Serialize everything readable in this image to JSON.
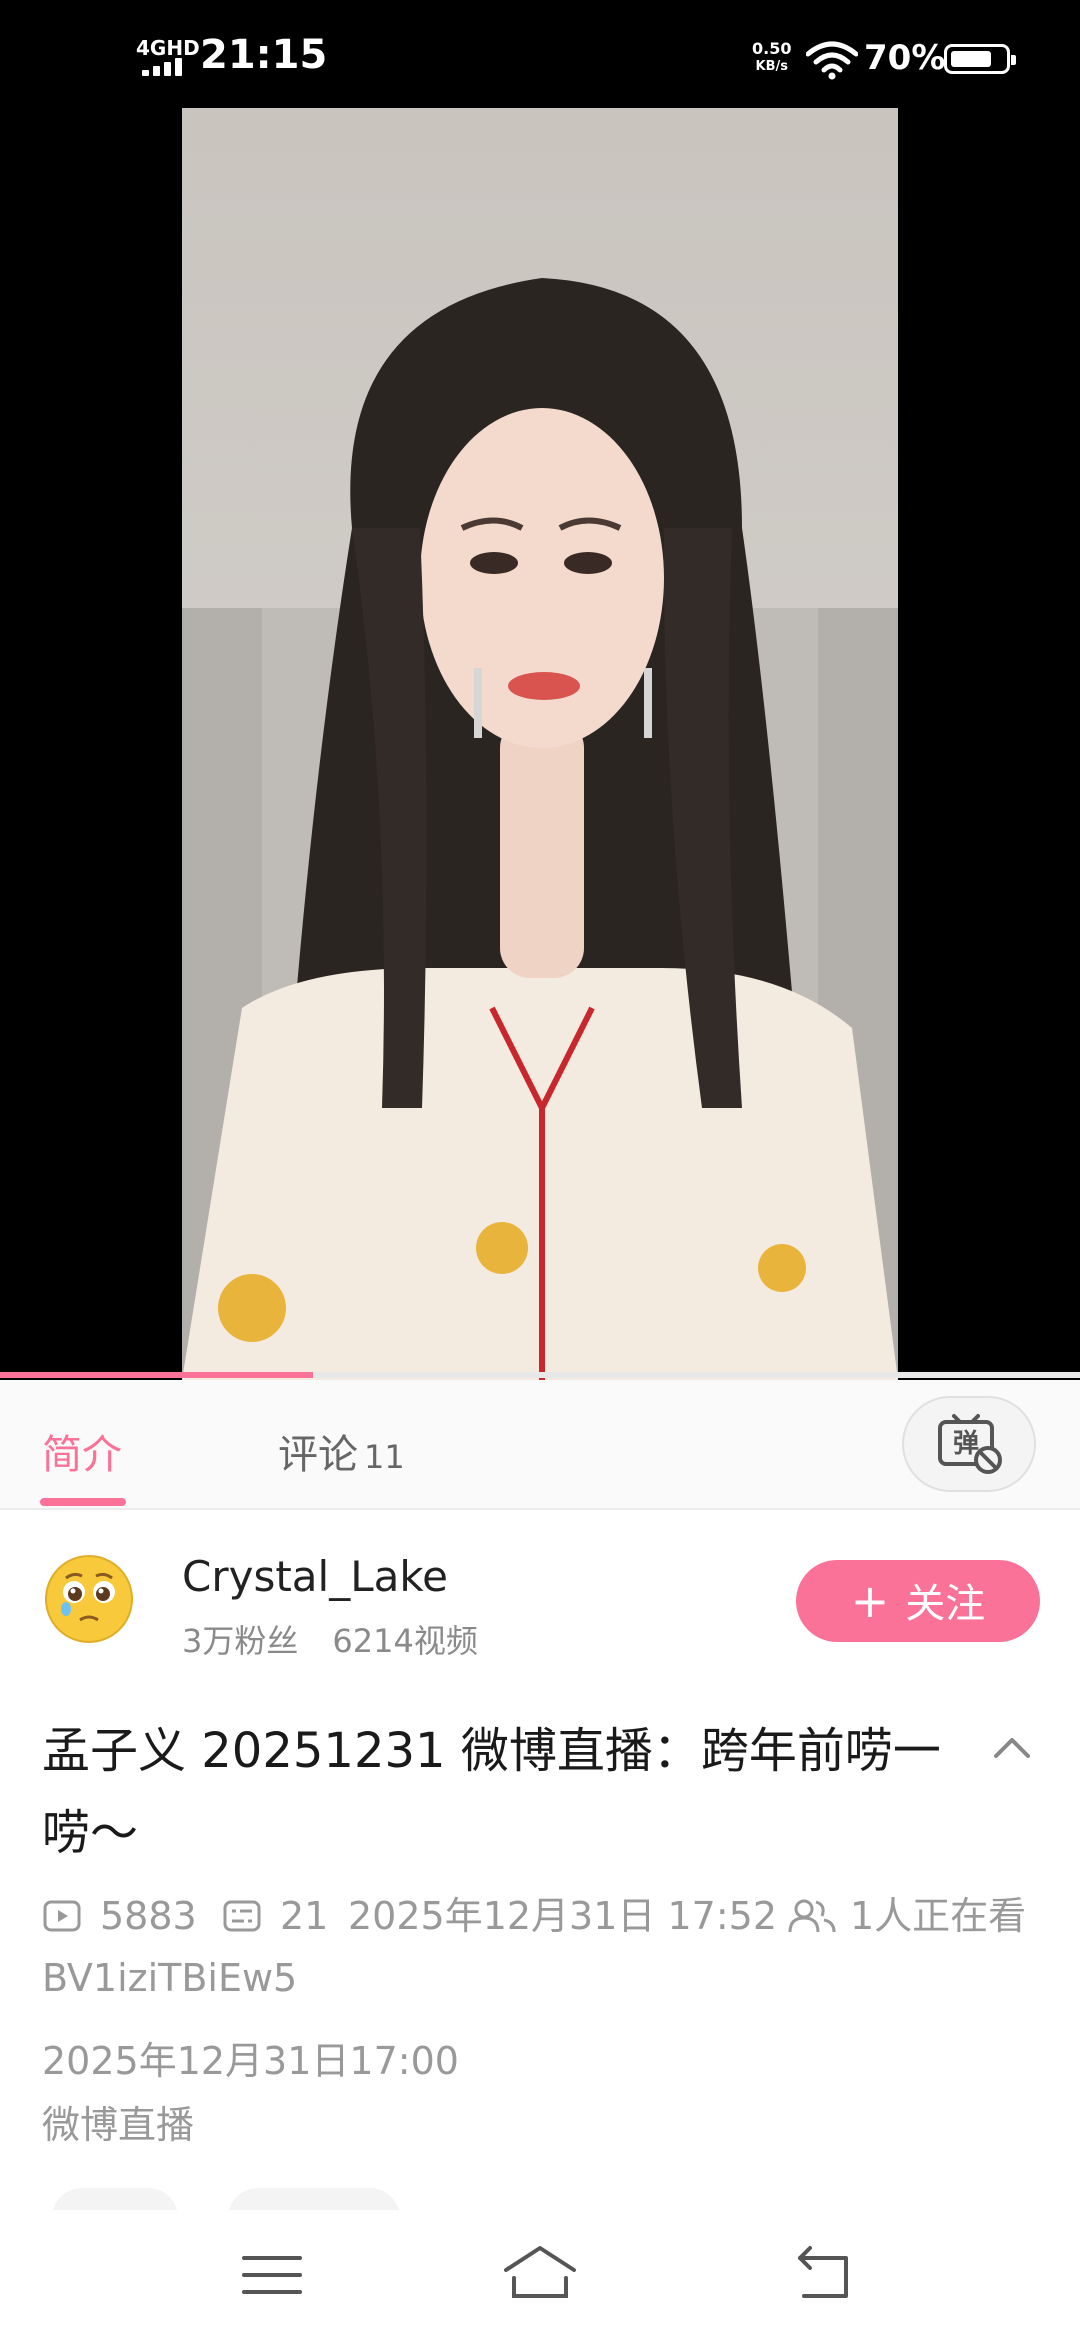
{
  "status_bar": {
    "network": "4GHD",
    "time": "21:15",
    "speed_value": "0.50",
    "speed_unit": "KB/s",
    "battery": "70%"
  },
  "video": {
    "progress": 0.29
  },
  "tabs": {
    "intro": "简介",
    "comments": "评论",
    "comments_count": "11",
    "danmaku_icon": "danmaku-off-icon"
  },
  "uploader": {
    "name": "Crystal_Lake",
    "fans": "3万粉丝",
    "videos": "6214视频",
    "follow_label": "关注",
    "avatar_icon": "pleading-face-emoji"
  },
  "title": "孟子义 20251231 微博直播：跨年前唠一唠～",
  "meta": {
    "views": "5883",
    "danmaku": "21",
    "upload_time": "2025年12月31日 17:52",
    "watching": "1人正在看",
    "bvid": "BV1iziTBiEw5"
  },
  "description": {
    "date": "2025年12月31日17:00",
    "text": "微博直播"
  },
  "nav": {
    "menu_icon": "menu-icon",
    "home_icon": "home-icon",
    "back_icon": "back-icon"
  },
  "colors": {
    "accent": "#fb7299"
  }
}
